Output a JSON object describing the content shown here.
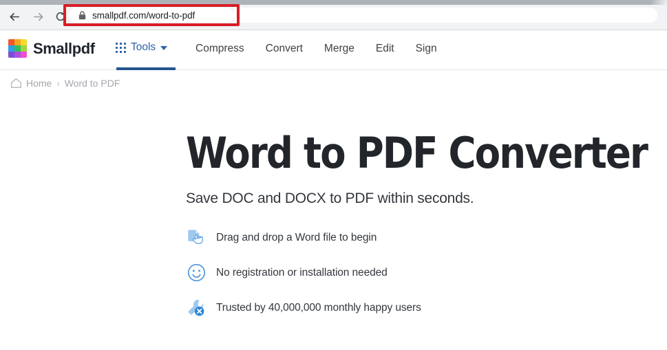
{
  "browser": {
    "back_icon": "back-arrow-icon",
    "forward_icon": "forward-arrow-icon",
    "reload_icon": "reload-icon",
    "lock_icon": "lock-icon",
    "url": "smallpdf.com/word-to-pdf",
    "highlight_color": "#d71d26"
  },
  "site_header": {
    "brand_name": "Smallpdf",
    "logo_colors": [
      "#f2582a",
      "#f5a623",
      "#f8d92b",
      "#2f9fe8",
      "#2fbe5f",
      "#9ed63c",
      "#7b4fd6",
      "#b14fe0",
      "#ef4fd0"
    ],
    "tools": {
      "label": "Tools",
      "accent_color": "#2d62a8"
    },
    "nav_links": [
      {
        "label": "Compress"
      },
      {
        "label": "Convert"
      },
      {
        "label": "Merge"
      },
      {
        "label": "Edit"
      },
      {
        "label": "Sign"
      }
    ]
  },
  "breadcrumb": {
    "home_icon": "home-icon",
    "items": [
      {
        "label": "Home"
      },
      {
        "label": "Word to PDF"
      }
    ],
    "separator": "›"
  },
  "hero": {
    "title": "Word to PDF Converter",
    "subtitle": "Save DOC and DOCX to PDF within seconds.",
    "features": [
      {
        "icon": "drag-drop-file-icon",
        "text": "Drag and drop a Word file to begin"
      },
      {
        "icon": "smiley-face-icon",
        "text": "No registration or installation needed"
      },
      {
        "icon": "wrench-icon",
        "text": "Trusted by 40,000,000 monthly happy users"
      }
    ]
  }
}
